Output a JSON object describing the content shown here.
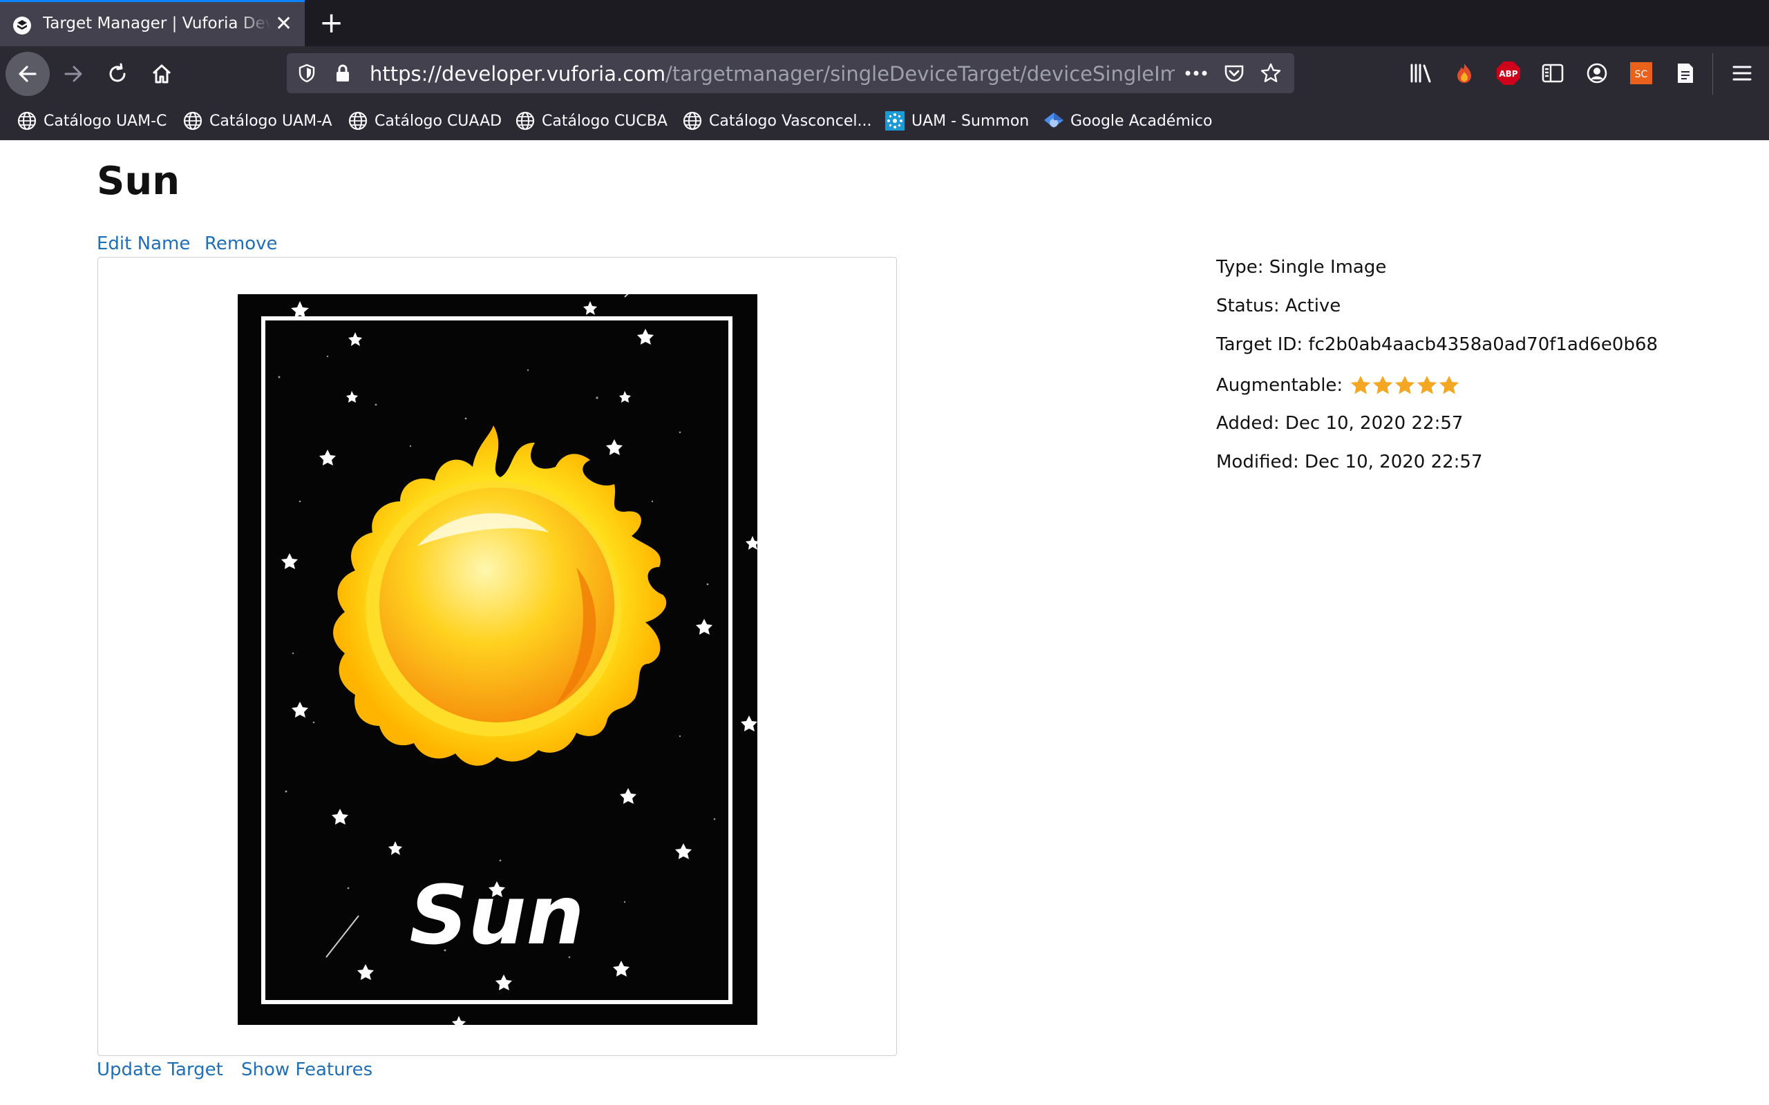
{
  "browser": {
    "tab_title": "Target Manager | Vuforia Developer Portal",
    "url_host": "https://developer.vuforia.com",
    "url_path": "/targetmanager/singleDeviceTarget/deviceSingleImageTargetD",
    "bookmarks": [
      {
        "label": "Catálogo UAM-C",
        "icon": "globe-icon"
      },
      {
        "label": "Catálogo UAM-A",
        "icon": "globe-icon"
      },
      {
        "label": "Catálogo CUAAD",
        "icon": "globe-icon"
      },
      {
        "label": "Catálogo CUCBA",
        "icon": "globe-icon"
      },
      {
        "label": "Catálogo Vasconcel...",
        "icon": "globe-icon"
      },
      {
        "label": "UAM - Summon",
        "icon": "summon-icon"
      },
      {
        "label": "Google Académico",
        "icon": "scholar-icon"
      }
    ],
    "extension_badges": {
      "abp": "ABP",
      "sc": "SC"
    }
  },
  "page": {
    "title": "Sun",
    "actions": {
      "edit_name": "Edit Name",
      "remove": "Remove"
    },
    "bottom_actions": {
      "update_target": "Update Target",
      "show_features": "Show Features"
    },
    "target_image": {
      "caption": "Sun"
    },
    "details": {
      "type": "Type: Single Image",
      "status": "Status: Active",
      "target_id": "Target ID: fc2b0ab4aacb4358a0ad70f1ad6e0b68",
      "augmentable_label": "Augmentable:",
      "augmentable_rating": 5,
      "augmentable_max": 5,
      "added": "Added: Dec 10, 2020 22:57",
      "modified": "Modified: Dec 10, 2020 22:57"
    }
  },
  "colors": {
    "link": "#1f6fb8",
    "star": "#f5a623",
    "tab_accent": "#0a84ff"
  }
}
